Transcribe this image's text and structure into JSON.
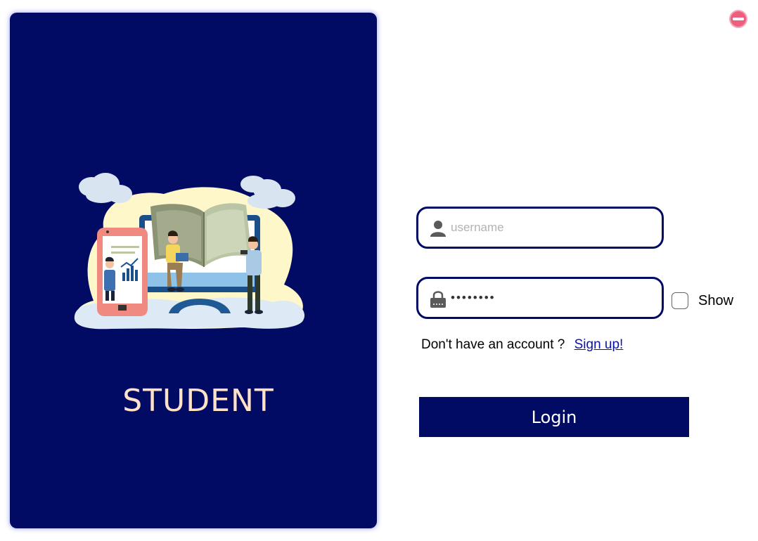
{
  "brand": {
    "title": "STUDENT",
    "illustration": "students-online-learning-illustration"
  },
  "window": {
    "close_icon": "close-icon"
  },
  "login_form": {
    "username": {
      "placeholder": "username",
      "value": "",
      "icon": "user-icon"
    },
    "password": {
      "value": "••••••••",
      "icon": "lock-icon"
    },
    "show_password": {
      "label": "Show",
      "checked": false
    },
    "signup_prompt": "Don't have an account ?",
    "signup_link": "Sign up!",
    "login_label": "Login"
  },
  "colors": {
    "primary": "#020b63",
    "brand_text": "#fde2c8",
    "link": "#0b12a6"
  }
}
